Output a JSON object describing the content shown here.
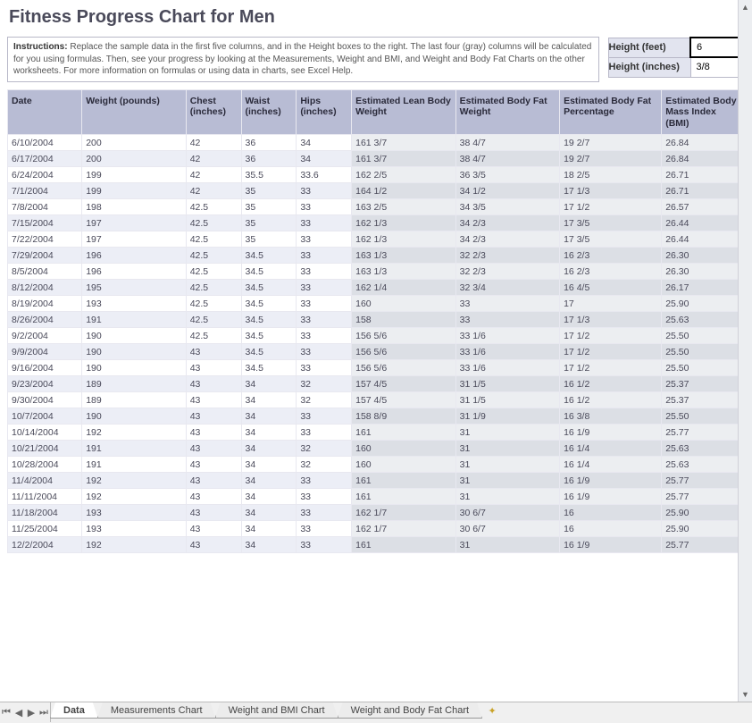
{
  "title": "Fitness Progress Chart for Men",
  "instructions_label": "Instructions:",
  "instructions_text": "Replace the sample data in the first five columns, and in the Height boxes to the right. The last four (gray) columns will be calculated for you using formulas. Then, see your progress by looking at the Measurements, Weight and BMI, and Weight and Body Fat Charts on the other worksheets. For more information on formulas or using data in charts, see Excel Help.",
  "height": {
    "feet_label": "Height (feet)",
    "feet_value": "6",
    "inches_label": "Height (inches)",
    "inches_value": "3/8"
  },
  "columns": [
    "Date",
    "Weight (pounds)",
    "Chest (inches)",
    "Waist (inches)",
    "Hips (inches)",
    "Estimated Lean Body Weight",
    "Estimated Body Fat Weight",
    "Estimated Body Fat Percentage",
    "Estimated Body Mass Index (BMI)"
  ],
  "rows": [
    {
      "date": "6/10/2004",
      "weight": "200",
      "chest": "42",
      "waist": "36",
      "hips": "34",
      "lean": "161 3/7",
      "bfw": "38 4/7",
      "bfp": "19 2/7",
      "bmi": "26.84"
    },
    {
      "date": "6/17/2004",
      "weight": "200",
      "chest": "42",
      "waist": "36",
      "hips": "34",
      "lean": "161 3/7",
      "bfw": "38 4/7",
      "bfp": "19 2/7",
      "bmi": "26.84"
    },
    {
      "date": "6/24/2004",
      "weight": "199",
      "chest": "42",
      "waist": "35.5",
      "hips": "33.6",
      "lean": "162 2/5",
      "bfw": "36 3/5",
      "bfp": "18 2/5",
      "bmi": "26.71"
    },
    {
      "date": "7/1/2004",
      "weight": "199",
      "chest": "42",
      "waist": "35",
      "hips": "33",
      "lean": "164 1/2",
      "bfw": "34 1/2",
      "bfp": "17 1/3",
      "bmi": "26.71"
    },
    {
      "date": "7/8/2004",
      "weight": "198",
      "chest": "42.5",
      "waist": "35",
      "hips": "33",
      "lean": "163 2/5",
      "bfw": "34 3/5",
      "bfp": "17 1/2",
      "bmi": "26.57"
    },
    {
      "date": "7/15/2004",
      "weight": "197",
      "chest": "42.5",
      "waist": "35",
      "hips": "33",
      "lean": "162 1/3",
      "bfw": "34 2/3",
      "bfp": "17 3/5",
      "bmi": "26.44"
    },
    {
      "date": "7/22/2004",
      "weight": "197",
      "chest": "42.5",
      "waist": "35",
      "hips": "33",
      "lean": "162 1/3",
      "bfw": "34 2/3",
      "bfp": "17 3/5",
      "bmi": "26.44"
    },
    {
      "date": "7/29/2004",
      "weight": "196",
      "chest": "42.5",
      "waist": "34.5",
      "hips": "33",
      "lean": "163 1/3",
      "bfw": "32 2/3",
      "bfp": "16 2/3",
      "bmi": "26.30"
    },
    {
      "date": "8/5/2004",
      "weight": "196",
      "chest": "42.5",
      "waist": "34.5",
      "hips": "33",
      "lean": "163 1/3",
      "bfw": "32 2/3",
      "bfp": "16 2/3",
      "bmi": "26.30"
    },
    {
      "date": "8/12/2004",
      "weight": "195",
      "chest": "42.5",
      "waist": "34.5",
      "hips": "33",
      "lean": "162 1/4",
      "bfw": "32 3/4",
      "bfp": "16 4/5",
      "bmi": "26.17"
    },
    {
      "date": "8/19/2004",
      "weight": "193",
      "chest": "42.5",
      "waist": "34.5",
      "hips": "33",
      "lean": "160",
      "bfw": "33",
      "bfp": "17",
      "bmi": "25.90"
    },
    {
      "date": "8/26/2004",
      "weight": "191",
      "chest": "42.5",
      "waist": "34.5",
      "hips": "33",
      "lean": "158",
      "bfw": "33",
      "bfp": "17 1/3",
      "bmi": "25.63"
    },
    {
      "date": "9/2/2004",
      "weight": "190",
      "chest": "42.5",
      "waist": "34.5",
      "hips": "33",
      "lean": "156 5/6",
      "bfw": "33 1/6",
      "bfp": "17 1/2",
      "bmi": "25.50"
    },
    {
      "date": "9/9/2004",
      "weight": "190",
      "chest": "43",
      "waist": "34.5",
      "hips": "33",
      "lean": "156 5/6",
      "bfw": "33 1/6",
      "bfp": "17 1/2",
      "bmi": "25.50"
    },
    {
      "date": "9/16/2004",
      "weight": "190",
      "chest": "43",
      "waist": "34.5",
      "hips": "33",
      "lean": "156 5/6",
      "bfw": "33 1/6",
      "bfp": "17 1/2",
      "bmi": "25.50"
    },
    {
      "date": "9/23/2004",
      "weight": "189",
      "chest": "43",
      "waist": "34",
      "hips": "32",
      "lean": "157 4/5",
      "bfw": "31 1/5",
      "bfp": "16 1/2",
      "bmi": "25.37"
    },
    {
      "date": "9/30/2004",
      "weight": "189",
      "chest": "43",
      "waist": "34",
      "hips": "32",
      "lean": "157 4/5",
      "bfw": "31 1/5",
      "bfp": "16 1/2",
      "bmi": "25.37"
    },
    {
      "date": "10/7/2004",
      "weight": "190",
      "chest": "43",
      "waist": "34",
      "hips": "33",
      "lean": "158 8/9",
      "bfw": "31 1/9",
      "bfp": "16 3/8",
      "bmi": "25.50"
    },
    {
      "date": "10/14/2004",
      "weight": "192",
      "chest": "43",
      "waist": "34",
      "hips": "33",
      "lean": "161",
      "bfw": "31",
      "bfp": "16 1/9",
      "bmi": "25.77"
    },
    {
      "date": "10/21/2004",
      "weight": "191",
      "chest": "43",
      "waist": "34",
      "hips": "32",
      "lean": "160",
      "bfw": "31",
      "bfp": "16 1/4",
      "bmi": "25.63"
    },
    {
      "date": "10/28/2004",
      "weight": "191",
      "chest": "43",
      "waist": "34",
      "hips": "32",
      "lean": "160",
      "bfw": "31",
      "bfp": "16 1/4",
      "bmi": "25.63"
    },
    {
      "date": "11/4/2004",
      "weight": "192",
      "chest": "43",
      "waist": "34",
      "hips": "33",
      "lean": "161",
      "bfw": "31",
      "bfp": "16 1/9",
      "bmi": "25.77"
    },
    {
      "date": "11/11/2004",
      "weight": "192",
      "chest": "43",
      "waist": "34",
      "hips": "33",
      "lean": "161",
      "bfw": "31",
      "bfp": "16 1/9",
      "bmi": "25.77"
    },
    {
      "date": "11/18/2004",
      "weight": "193",
      "chest": "43",
      "waist": "34",
      "hips": "33",
      "lean": "162 1/7",
      "bfw": "30 6/7",
      "bfp": "16",
      "bmi": "25.90"
    },
    {
      "date": "11/25/2004",
      "weight": "193",
      "chest": "43",
      "waist": "34",
      "hips": "33",
      "lean": "162 1/7",
      "bfw": "30 6/7",
      "bfp": "16",
      "bmi": "25.90"
    },
    {
      "date": "12/2/2004",
      "weight": "192",
      "chest": "43",
      "waist": "34",
      "hips": "33",
      "lean": "161",
      "bfw": "31",
      "bfp": "16 1/9",
      "bmi": "25.77"
    }
  ],
  "tabs": [
    {
      "label": "Data",
      "active": true
    },
    {
      "label": "Measurements Chart",
      "active": false
    },
    {
      "label": "Weight and BMI Chart",
      "active": false
    },
    {
      "label": "Weight and Body Fat Chart",
      "active": false
    }
  ],
  "chart_data": {
    "type": "table",
    "title": "Fitness Progress Chart for Men",
    "columns": [
      "Date",
      "Weight (pounds)",
      "Chest (inches)",
      "Waist (inches)",
      "Hips (inches)",
      "Estimated Lean Body Weight",
      "Estimated Body Fat Weight",
      "Estimated Body Fat Percentage",
      "Estimated Body Mass Index (BMI)"
    ],
    "series": [
      {
        "name": "Weight (pounds)",
        "x": [
          "6/10/2004",
          "6/17/2004",
          "6/24/2004",
          "7/1/2004",
          "7/8/2004",
          "7/15/2004",
          "7/22/2004",
          "7/29/2004",
          "8/5/2004",
          "8/12/2004",
          "8/19/2004",
          "8/26/2004",
          "9/2/2004",
          "9/9/2004",
          "9/16/2004",
          "9/23/2004",
          "9/30/2004",
          "10/7/2004",
          "10/14/2004",
          "10/21/2004",
          "10/28/2004",
          "11/4/2004",
          "11/11/2004",
          "11/18/2004",
          "11/25/2004",
          "12/2/2004"
        ],
        "values": [
          200,
          200,
          199,
          199,
          198,
          197,
          197,
          196,
          196,
          195,
          193,
          191,
          190,
          190,
          190,
          189,
          189,
          190,
          192,
          191,
          191,
          192,
          192,
          193,
          193,
          192
        ]
      },
      {
        "name": "BMI",
        "values": [
          26.84,
          26.84,
          26.71,
          26.71,
          26.57,
          26.44,
          26.44,
          26.3,
          26.3,
          26.17,
          25.9,
          25.63,
          25.5,
          25.5,
          25.5,
          25.37,
          25.37,
          25.5,
          25.77,
          25.63,
          25.63,
          25.77,
          25.77,
          25.9,
          25.9,
          25.77
        ]
      }
    ]
  }
}
